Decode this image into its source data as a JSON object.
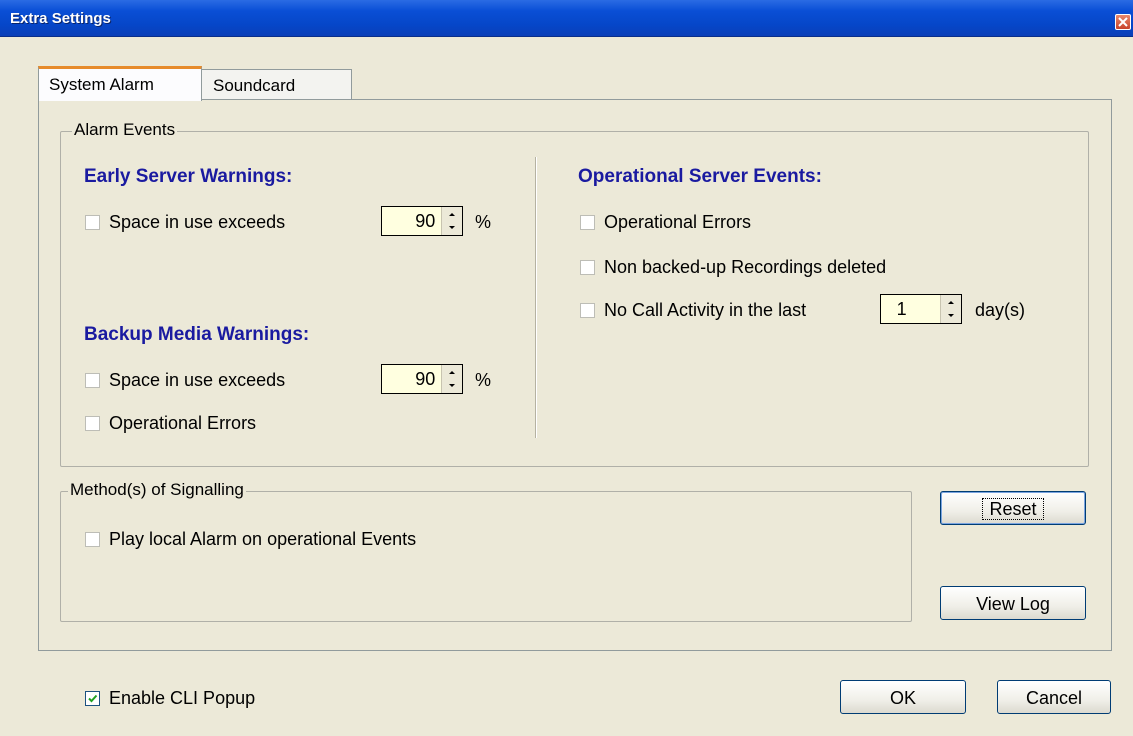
{
  "window": {
    "title": "Extra Settings"
  },
  "tabs": [
    {
      "label": "System Alarm"
    },
    {
      "label": "Soundcard"
    }
  ],
  "alarm_events": {
    "legend": "Alarm Events",
    "early_server": {
      "heading": "Early Server Warnings:",
      "space_label": "Space in use exceeds",
      "space_value": "90",
      "unit": "%"
    },
    "backup_media": {
      "heading": "Backup Media Warnings:",
      "space_label": "Space in use exceeds",
      "space_value": "90",
      "unit": "%",
      "errors_label": "Operational Errors"
    },
    "operational": {
      "heading": "Operational Server Events:",
      "errors_label": "Operational Errors",
      "deleted_label": "Non backed-up Recordings deleted",
      "no_call_label": "No Call Activity in the last",
      "no_call_value": "1",
      "unit": "day(s)"
    }
  },
  "signalling": {
    "legend": "Method(s) of Signalling",
    "play_alarm_label": "Play local Alarm on operational Events"
  },
  "buttons": {
    "reset": "Reset",
    "view_log": "View Log",
    "ok": "OK",
    "cancel": "Cancel"
  },
  "footer": {
    "enable_cli_label": "Enable CLI Popup",
    "enable_cli_checked": true
  },
  "colors": {
    "titlebar": "#0646c8",
    "heading": "#1a1aa0",
    "spin_bg": "#ffffe0",
    "dialog_bg": "#ECE9D8"
  }
}
